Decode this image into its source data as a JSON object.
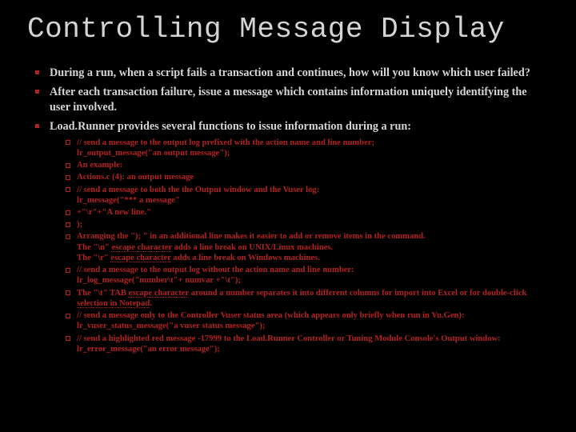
{
  "title": "Controlling Message Display",
  "main": [
    "During a run, when a script fails a transaction and continues, how will you know which user failed?",
    "After each transaction failure, issue a message which contains information uniquely identifying the user involved.",
    "Load.Runner provides several functions to issue information during a run:"
  ],
  "sub": [
    {
      "lines": [
        "// send a message to the output log prefixed with the action name and line number;",
        "lr_output_message(\"an output message\");"
      ]
    },
    {
      "lines": [
        "An example:"
      ]
    },
    {
      "lines": [
        "Actions.c (4): an output message"
      ]
    },
    {
      "lines": [
        "// send a message to both the the Output window and the Vuser log:",
        "lr_message(\"*** a message\""
      ]
    },
    {
      "lines": [
        "+\"\\r\"+\"A new line.\""
      ]
    },
    {
      "lines": [
        ");"
      ]
    },
    {
      "lines": [
        "Arranging the \"); \" in an additional line makes it easier to add or remove items in the command."
      ],
      "extras": [
        {
          "pre": "The \"\\n\" ",
          "u": "escape character",
          "post": " adds a line break on UNIX/Linux machines."
        },
        {
          "pre": "The \"\\r\" ",
          "u": "escape character",
          "post": " adds a line break on Windows machines."
        }
      ]
    },
    {
      "lines": [
        "// send a message to the output log without the action name and line number:",
        "lr_log_message(\"number\\t\"+ numvar +\"\\t\");"
      ]
    },
    {
      "extras": [
        {
          "pre": "The \"\\t\" TAB ",
          "u": "escape character",
          "post": " around a number separates it into different columns for import into Excel or for double-click "
        },
        {
          "pre": "",
          "u": "selection in Notepad",
          "post": "."
        }
      ],
      "extrasInline": true
    },
    {
      "lines": [
        "// send a message only to the Controller Vuser status area (which appears only briefly when run in Vu.Gen):",
        "lr_vuser_status_message(\"a vuser status message\");"
      ]
    },
    {
      "lines": [
        "// send a highlighted red message -17999 to the Load.Runner Controller or Tuning Module Console's Output window:",
        "lr_error_message(\"an error message\");"
      ]
    }
  ]
}
